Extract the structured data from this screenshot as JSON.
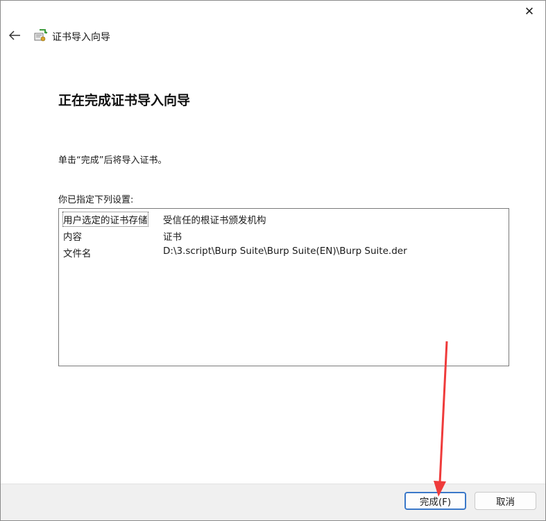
{
  "window": {
    "close_glyph": "✕"
  },
  "header": {
    "title": "证书导入向导",
    "icon": "certificate-wizard-icon"
  },
  "main": {
    "heading": "正在完成证书导入向导",
    "instruction": "单击“完成”后将导入证书。",
    "settings_label": "你已指定下列设置:",
    "settings": [
      {
        "key": "用户选定的证书存储",
        "value": "受信任的根证书颁发机构"
      },
      {
        "key": "内容",
        "value": "证书"
      },
      {
        "key": "文件名",
        "value": "D:\\3.script\\Burp Suite\\Burp Suite(EN)\\Burp Suite.der"
      }
    ]
  },
  "footer": {
    "finish_label": "完成(F)",
    "cancel_label": "取消"
  },
  "colors": {
    "accent": "#3a78c9",
    "annotation_arrow": "#ef3b3b"
  }
}
